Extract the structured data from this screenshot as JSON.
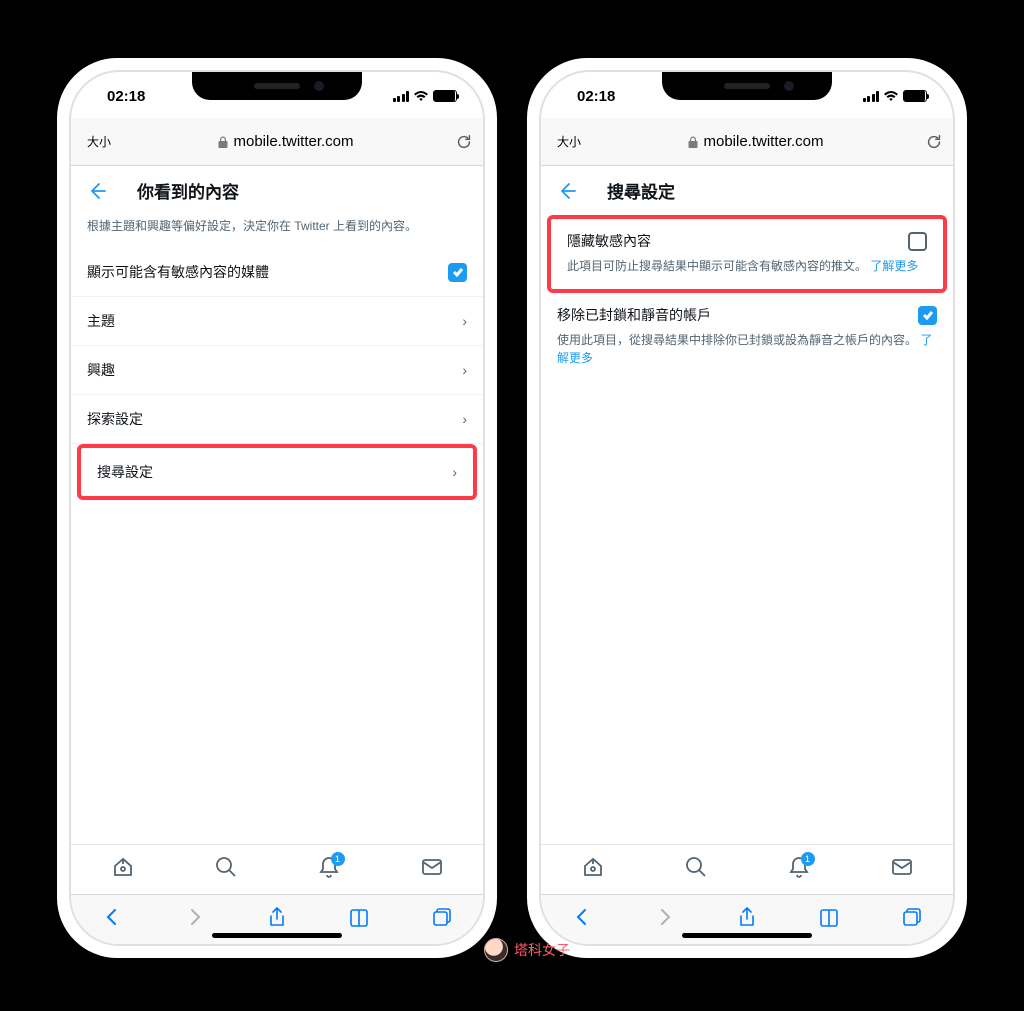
{
  "status": {
    "time": "02:18"
  },
  "safari": {
    "aa": "大小",
    "url": "mobile.twitter.com"
  },
  "phone1": {
    "title": "你看到的內容",
    "desc": "根據主題和興趣等偏好設定，決定你在 Twitter 上看到的內容。",
    "rows": {
      "media": "顯示可能含有敏感內容的媒體",
      "topics": "主題",
      "interests": "興趣",
      "explore": "探索設定",
      "search": "搜尋設定"
    }
  },
  "phone2": {
    "title": "搜尋設定",
    "setting1": {
      "title": "隱藏敏感內容",
      "desc": "此項目可防止搜尋結果中顯示可能含有敏感內容的推文。 ",
      "learn": "了解更多"
    },
    "setting2": {
      "title": "移除已封鎖和靜音的帳戶",
      "desc": "使用此項目，從搜尋結果中排除你已封鎖或設為靜音之帳戶的內容。 ",
      "learn": "了解更多"
    }
  },
  "tabs": {
    "notif_count": "1"
  },
  "watermark": "塔科女子"
}
